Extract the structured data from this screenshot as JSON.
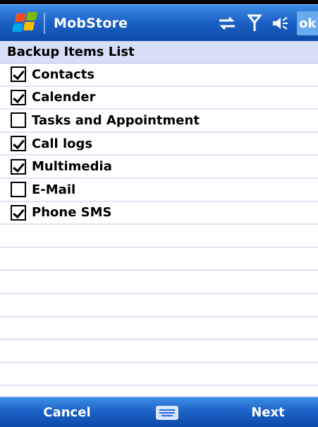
{
  "title_bar": {
    "app_title": "MobStore",
    "ok_label": "ok",
    "icons": [
      "windows-start-icon",
      "sync-icon",
      "signal-icon",
      "speaker-icon"
    ]
  },
  "list": {
    "header": "Backup Items List",
    "items": [
      {
        "label": "Contacts",
        "checked": true
      },
      {
        "label": "Calender",
        "checked": true
      },
      {
        "label": "Tasks and Appointment",
        "checked": false
      },
      {
        "label": "Call logs",
        "checked": true
      },
      {
        "label": "Multimedia",
        "checked": true
      },
      {
        "label": "E-Mail",
        "checked": false
      },
      {
        "label": "Phone SMS",
        "checked": true
      }
    ]
  },
  "softkeys": {
    "left": "Cancel",
    "right": "Next",
    "center_icon": "keyboard-icon"
  },
  "colors": {
    "bar_blue": "#1d63c8",
    "header_bg": "#d6dff7",
    "row_line": "#dde3f2"
  }
}
